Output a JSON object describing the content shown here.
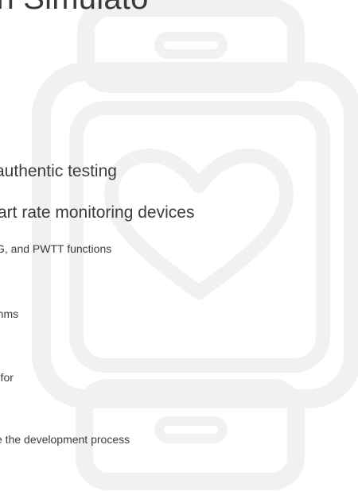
{
  "slide": {
    "heading": "e Multi-Vital Sign Simulato",
    "lines": [
      "authentic testing",
      "art rate monitoring devices",
      "G, and PWTT functions",
      "rithms",
      "r for",
      "e the development process"
    ]
  },
  "background": {
    "icon": "smartwatch-heart-icon",
    "stroke_color": "#f1f1f1"
  }
}
